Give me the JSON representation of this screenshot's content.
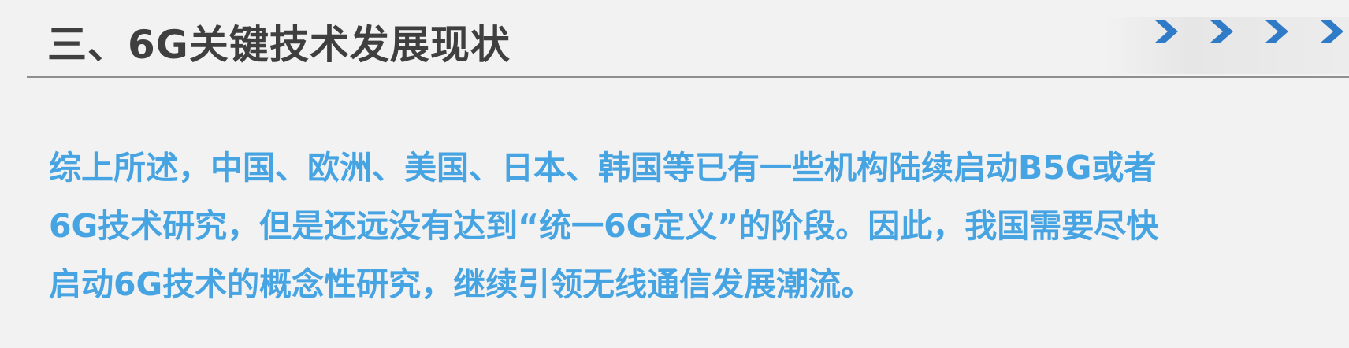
{
  "slide": {
    "title": "三、6G关键技术发展现状",
    "body_lines": [
      "综上所述，中国、欧洲、美国、日本、韩国等已有一些机构陆续启动B5G或者",
      "6G技术研究，但是还远没有达到“统一6G定义”的阶段。因此，我国需要尽快",
      "启动6G技术的概念性研究，继续引领无线通信发展潮流。"
    ],
    "decoration": {
      "icon": "chevron-right-icon",
      "count": 4,
      "color": "#2f7bc8"
    },
    "colors": {
      "title": "#3f3f3f",
      "body": "#47a4e2",
      "background": "#f2f2f2"
    }
  }
}
